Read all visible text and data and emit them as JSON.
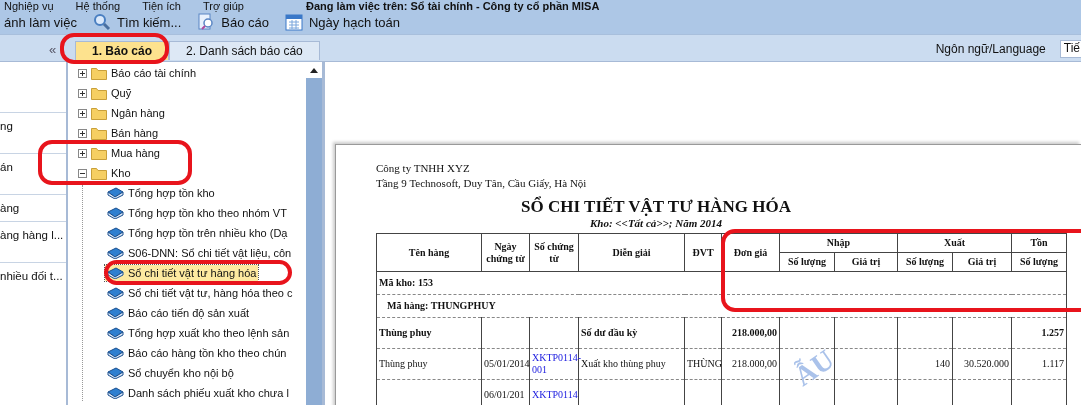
{
  "menu": [
    {
      "label": "Nghiệp vụ"
    },
    {
      "label": "Hệ thống"
    },
    {
      "label": "Tiện ích"
    },
    {
      "label": "Trợ giúp"
    }
  ],
  "window": {
    "title": "Đang làm việc trên: Sổ tài chính - Công ty cổ phần MISA"
  },
  "toolbar": [
    {
      "label": "ánh làm việc",
      "kind": "plain"
    },
    {
      "label": "Tìm kiếm...",
      "kind": "search"
    },
    {
      "label": "Báo cáo",
      "kind": "report"
    },
    {
      "label": "Ngày hạch toán",
      "kind": "calendar"
    }
  ],
  "collapse_button": "«",
  "tabs": [
    {
      "label": "1. Báo cáo",
      "selected": true
    },
    {
      "label": "2. Danh sách báo cáo",
      "selected": false
    }
  ],
  "language": {
    "label": "Ngôn ngữ/Language",
    "value": "Tiế"
  },
  "left_list": [
    {
      "label": "ng"
    },
    {
      "label": "án"
    },
    {
      "label": "àng"
    },
    {
      "label": "àng hàng l..."
    },
    {
      "label": "nhiều đối t..."
    }
  ],
  "tree": [
    {
      "label": "Báo cáo tài chính",
      "kind": "folder",
      "expanded": false,
      "selected": false
    },
    {
      "label": "Quỹ",
      "kind": "folder",
      "expanded": false,
      "selected": false
    },
    {
      "label": "Ngân hàng",
      "kind": "folder",
      "expanded": false,
      "selected": false
    },
    {
      "label": "Bán hàng",
      "kind": "folder",
      "expanded": false,
      "selected": false
    },
    {
      "label": "Mua hàng",
      "kind": "folder",
      "expanded": false,
      "selected": false
    },
    {
      "label": "Kho",
      "kind": "folder",
      "expanded": true,
      "selected": false,
      "children": [
        {
          "label": "Tổng hợp tồn kho",
          "kind": "report",
          "selected": false
        },
        {
          "label": "Tổng hợp tồn kho theo nhóm VT",
          "kind": "report",
          "selected": false
        },
        {
          "label": "Tổng hợp tồn trên nhiều kho (Dạ",
          "kind": "report",
          "selected": false
        },
        {
          "label": "S06-DNN: Sổ chi tiết vật liệu, côn",
          "kind": "report",
          "selected": false
        },
        {
          "label": "Sổ chi tiết vật tư hàng hóa",
          "kind": "report",
          "selected": true
        },
        {
          "label": "Sổ chi tiết vật tư, hàng hóa theo c",
          "kind": "report",
          "selected": false
        },
        {
          "label": "Báo cáo tiến độ sản xuất",
          "kind": "report",
          "selected": false
        },
        {
          "label": "Tổng hợp xuất kho theo lệnh sản",
          "kind": "report",
          "selected": false
        },
        {
          "label": "Báo cáo hàng tồn kho theo chún",
          "kind": "report",
          "selected": false
        },
        {
          "label": "Sổ chuyển kho nội bộ",
          "kind": "report",
          "selected": false
        },
        {
          "label": "Danh sách phiếu xuất kho chưa l",
          "kind": "report",
          "selected": false
        }
      ]
    }
  ],
  "report": {
    "company": "Công ty TNHH XYZ",
    "address": "Tầng 9 Technosoft, Duy Tân, Cầu Giấy, Hà Nội",
    "title": "SỔ CHI TIẾT VẬT TƯ HÀNG HÓA",
    "subtitle": "Kho: <<Tất cả>>; Năm 2014",
    "columns": [
      {
        "label": "Tên hàng"
      },
      {
        "label": "Ngày chứng từ"
      },
      {
        "label": "Số chứng từ"
      },
      {
        "label": "Diễn giải"
      },
      {
        "label": "ĐVT"
      },
      {
        "label": "Đơn giá"
      },
      {
        "label": "Nhập",
        "sub": [
          "Số lượng",
          "Giá trị"
        ]
      },
      {
        "label": "Xuất",
        "sub": [
          "Số lượng",
          "Giá trị"
        ]
      },
      {
        "label": "Tồn",
        "sub": [
          "Số lượng"
        ]
      }
    ],
    "rows": [
      {
        "kind": "group",
        "text": "Mã kho: 153"
      },
      {
        "kind": "subgroup",
        "text": "Mã hàng: THUNGPHUY"
      },
      {
        "kind": "opening",
        "cells": [
          "Thùng phuy",
          "",
          "",
          "Số dư đầu kỳ",
          "",
          "218.000,00",
          "",
          "",
          "",
          "",
          "1.257"
        ]
      },
      {
        "kind": "detail",
        "cells": [
          "Thùng phuy",
          "05/01/2014",
          "XKTP0114-001",
          "Xuất kho thùng phuy",
          "THÙNG",
          "218.000,00",
          "",
          "",
          "140",
          "30.520.000",
          "1.117"
        ]
      },
      {
        "kind": "detail",
        "cells": [
          "",
          "06/01/201",
          "XKTP0114",
          "",
          "",
          "",
          "",
          "",
          "",
          "",
          ""
        ]
      }
    ],
    "watermark": "ẪU"
  }
}
